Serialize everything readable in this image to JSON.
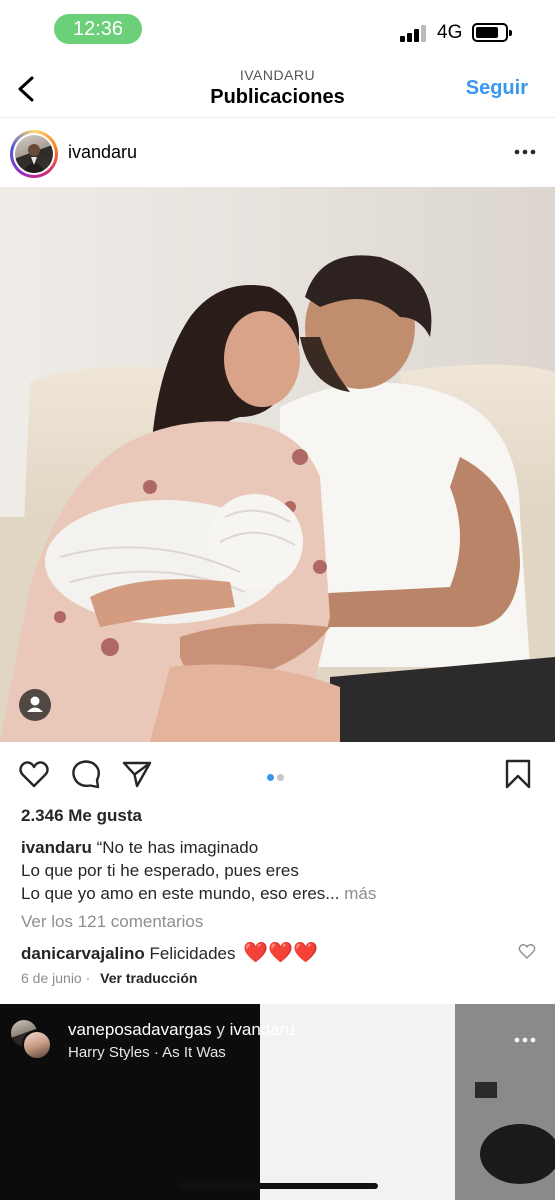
{
  "status_bar": {
    "time": "12:36",
    "network": "4G",
    "accent_color": "#6cd07a"
  },
  "header": {
    "username_caps": "IVANDARU",
    "title": "Publicaciones",
    "follow_label": "Seguir",
    "follow_color": "#3897f0"
  },
  "post": {
    "username": "ivandaru",
    "image_count": 2,
    "image_active": 1,
    "likes": "2.346 Me gusta",
    "caption_user": "ivandaru",
    "caption_line1": "“No te has imaginado",
    "caption_line2": "Lo que por ti he esperado, pues eres",
    "caption_line3": "Lo que yo amo en este mundo, eso eres...",
    "caption_more": "más",
    "view_comments": "Ver los 121 comentarios",
    "comment_user": "danicarvajalino",
    "comment_text": "Felicidades",
    "comment_emoji": "❤️❤️❤️",
    "date": "6 de junio",
    "translate": "Ver traducción"
  },
  "next_post": {
    "user1": "vaneposadavargas",
    "conj": "y",
    "user2": "ivandaru",
    "music": "Harry Styles · As It Was"
  },
  "icons": {
    "back": "chevron-left-icon",
    "more": "more-horizontal-icon",
    "like": "heart-icon",
    "comment": "comment-bubble-icon",
    "share": "paper-plane-icon",
    "save": "bookmark-icon",
    "tag": "person-tag-icon"
  }
}
